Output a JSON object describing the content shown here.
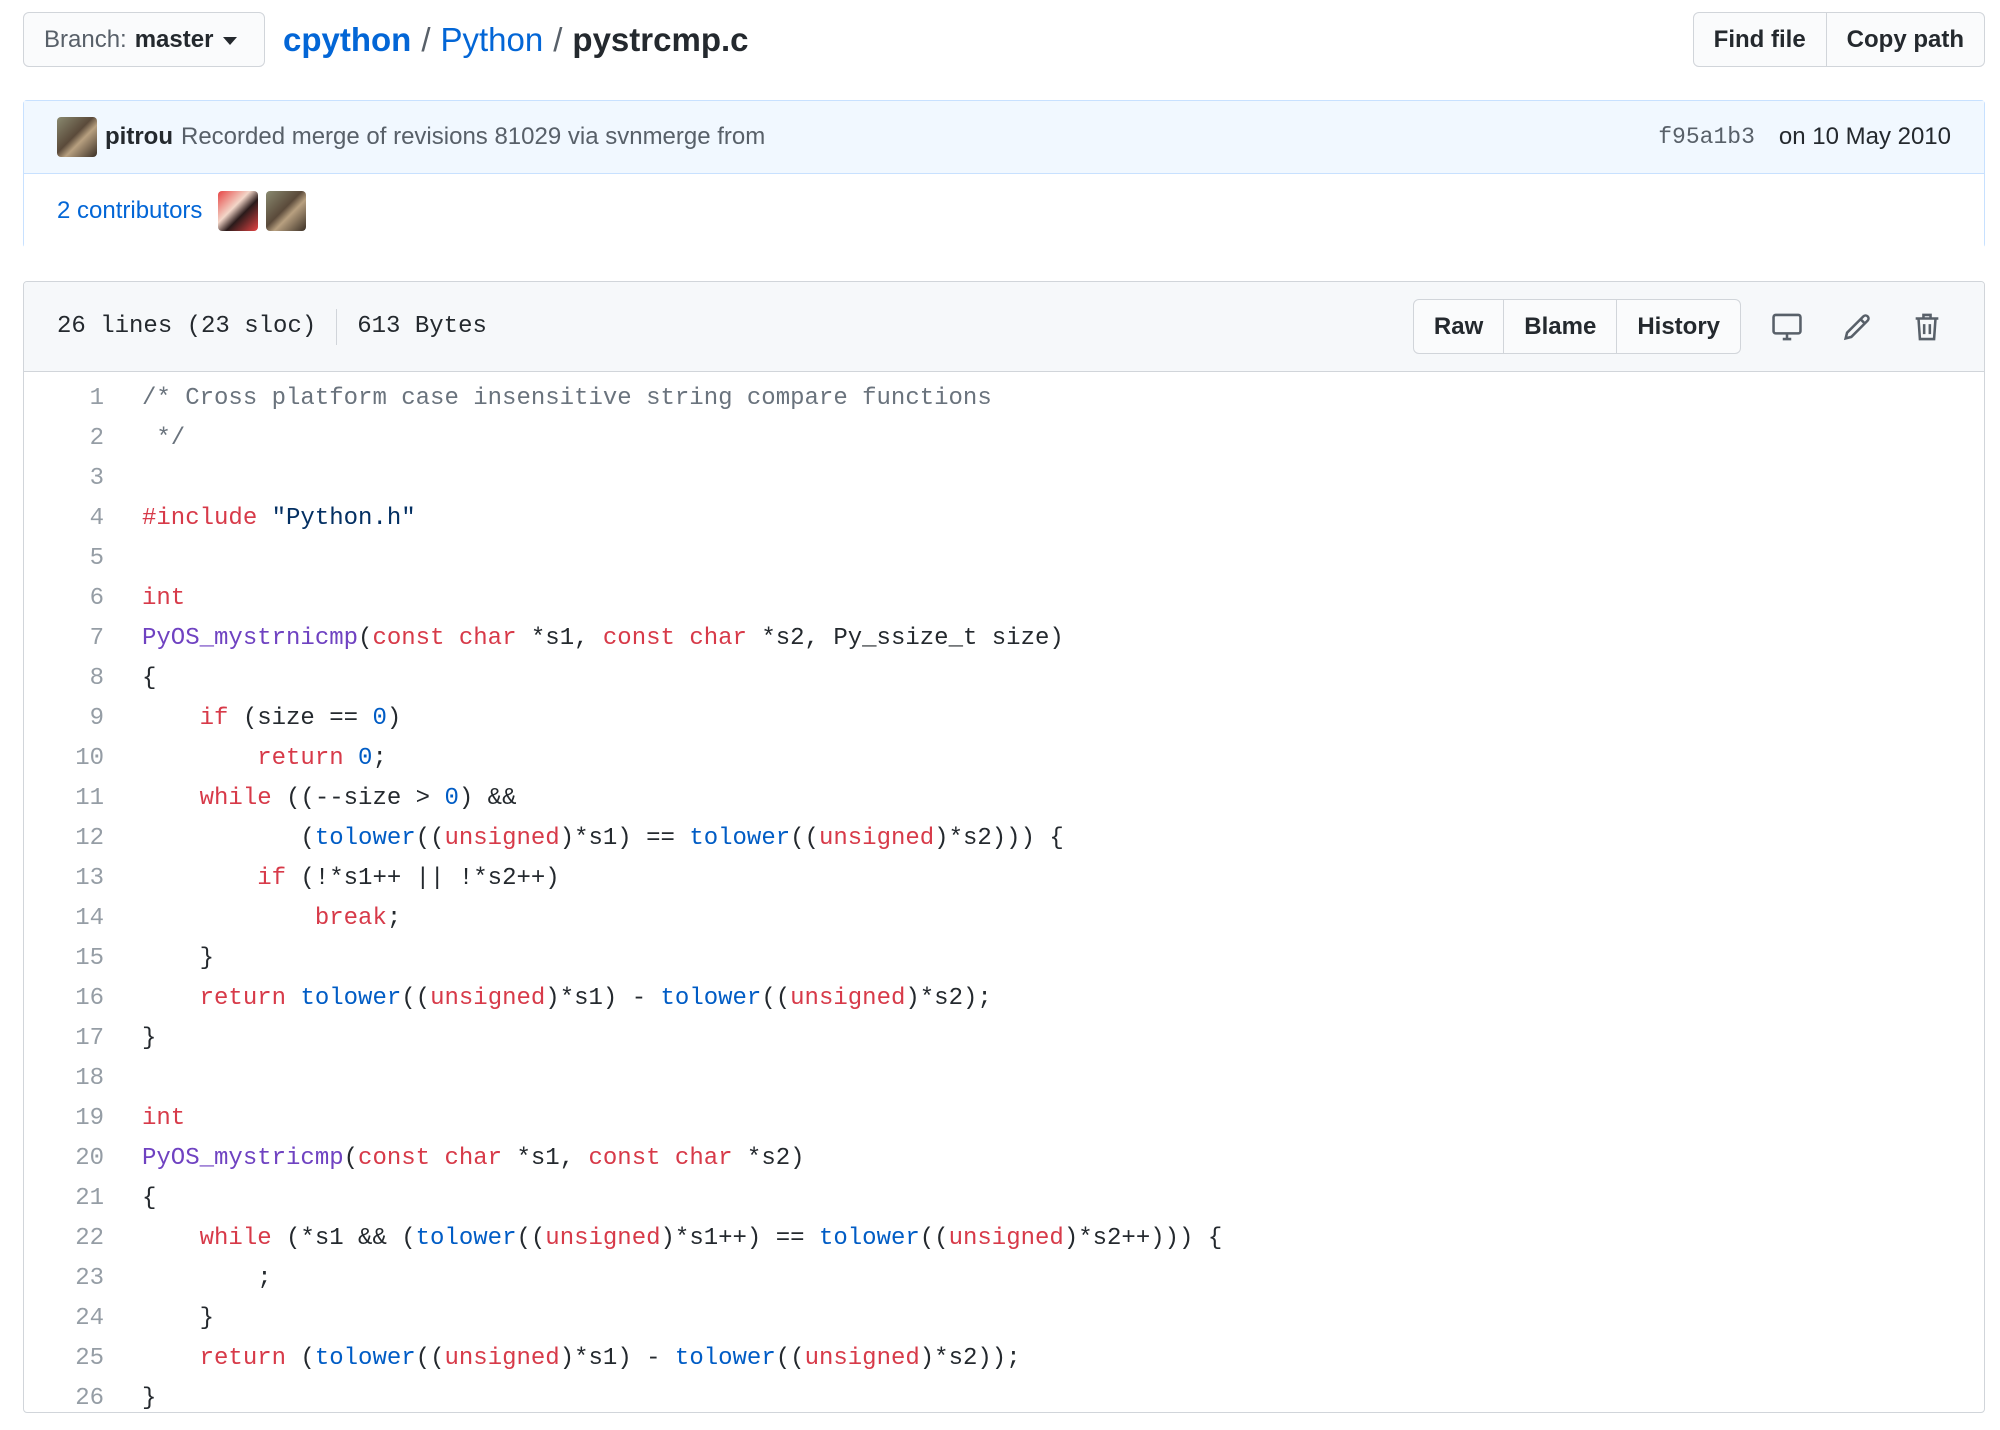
{
  "topbar": {
    "branch_label": "Branch:",
    "branch_value": "master",
    "breadcrumb": {
      "repo": "cpython",
      "sep1": "/",
      "dir": "Python",
      "sep2": "/",
      "file": "pystrcmp.c"
    },
    "find_file": "Find file",
    "copy_path": "Copy path"
  },
  "commit": {
    "author": "pitrou",
    "message": "Recorded merge of revisions 81029 via svnmerge from",
    "sha": "f95a1b3",
    "date": "on 10 May 2010",
    "contributors": "2 contributors"
  },
  "file": {
    "lines_info": "26 lines (23 sloc)",
    "size": "613 Bytes",
    "raw": "Raw",
    "blame": "Blame",
    "history": "History"
  },
  "code": {
    "lines": [
      [
        [
          "c",
          "/* Cross platform case insensitive string compare functions"
        ]
      ],
      [
        [
          "c",
          " */"
        ]
      ],
      [],
      [
        [
          "k",
          "#include"
        ],
        [
          "p",
          " "
        ],
        [
          "s",
          "\"Python.h\""
        ]
      ],
      [],
      [
        [
          "k",
          "int"
        ]
      ],
      [
        [
          "f",
          "PyOS_mystrnicmp"
        ],
        [
          "p",
          "("
        ],
        [
          "k",
          "const"
        ],
        [
          "p",
          " "
        ],
        [
          "k",
          "char"
        ],
        [
          "p",
          " *s1, "
        ],
        [
          "k",
          "const"
        ],
        [
          "p",
          " "
        ],
        [
          "k",
          "char"
        ],
        [
          "p",
          " *s2, Py_ssize_t size)"
        ]
      ],
      [
        [
          "p",
          "{"
        ]
      ],
      [
        [
          "p",
          "    "
        ],
        [
          "k",
          "if"
        ],
        [
          "p",
          " (size == "
        ],
        [
          "n",
          "0"
        ],
        [
          "p",
          ")"
        ]
      ],
      [
        [
          "p",
          "        "
        ],
        [
          "k",
          "return"
        ],
        [
          "p",
          " "
        ],
        [
          "n",
          "0"
        ],
        [
          "p",
          ";"
        ]
      ],
      [
        [
          "p",
          "    "
        ],
        [
          "k",
          "while"
        ],
        [
          "p",
          " ((--size > "
        ],
        [
          "n",
          "0"
        ],
        [
          "p",
          ") &&"
        ]
      ],
      [
        [
          "p",
          "           ("
        ],
        [
          "n",
          "tolower"
        ],
        [
          "p",
          "(("
        ],
        [
          "k",
          "unsigned"
        ],
        [
          "p",
          ")*s1) == "
        ],
        [
          "n",
          "tolower"
        ],
        [
          "p",
          "(("
        ],
        [
          "k",
          "unsigned"
        ],
        [
          "p",
          ")*s2))) {"
        ]
      ],
      [
        [
          "p",
          "        "
        ],
        [
          "k",
          "if"
        ],
        [
          "p",
          " (!*s1++ || !*s2++)"
        ]
      ],
      [
        [
          "p",
          "            "
        ],
        [
          "k",
          "break"
        ],
        [
          "p",
          ";"
        ]
      ],
      [
        [
          "p",
          "    }"
        ]
      ],
      [
        [
          "p",
          "    "
        ],
        [
          "k",
          "return"
        ],
        [
          "p",
          " "
        ],
        [
          "n",
          "tolower"
        ],
        [
          "p",
          "(("
        ],
        [
          "k",
          "unsigned"
        ],
        [
          "p",
          ")*s1) - "
        ],
        [
          "n",
          "tolower"
        ],
        [
          "p",
          "(("
        ],
        [
          "k",
          "unsigned"
        ],
        [
          "p",
          ")*s2);"
        ]
      ],
      [
        [
          "p",
          "}"
        ]
      ],
      [],
      [
        [
          "k",
          "int"
        ]
      ],
      [
        [
          "f",
          "PyOS_mystricmp"
        ],
        [
          "p",
          "("
        ],
        [
          "k",
          "const"
        ],
        [
          "p",
          " "
        ],
        [
          "k",
          "char"
        ],
        [
          "p",
          " *s1, "
        ],
        [
          "k",
          "const"
        ],
        [
          "p",
          " "
        ],
        [
          "k",
          "char"
        ],
        [
          "p",
          " *s2)"
        ]
      ],
      [
        [
          "p",
          "{"
        ]
      ],
      [
        [
          "p",
          "    "
        ],
        [
          "k",
          "while"
        ],
        [
          "p",
          " (*s1 && ("
        ],
        [
          "n",
          "tolower"
        ],
        [
          "p",
          "(("
        ],
        [
          "k",
          "unsigned"
        ],
        [
          "p",
          ")*s1++) == "
        ],
        [
          "n",
          "tolower"
        ],
        [
          "p",
          "(("
        ],
        [
          "k",
          "unsigned"
        ],
        [
          "p",
          ")*s2++))) {"
        ]
      ],
      [
        [
          "p",
          "        ;"
        ]
      ],
      [
        [
          "p",
          "    }"
        ]
      ],
      [
        [
          "p",
          "    "
        ],
        [
          "k",
          "return"
        ],
        [
          "p",
          " ("
        ],
        [
          "n",
          "tolower"
        ],
        [
          "p",
          "(("
        ],
        [
          "k",
          "unsigned"
        ],
        [
          "p",
          ")*s1) - "
        ],
        [
          "n",
          "tolower"
        ],
        [
          "p",
          "(("
        ],
        [
          "k",
          "unsigned"
        ],
        [
          "p",
          ")*s2));"
        ]
      ],
      [
        [
          "p",
          "}"
        ]
      ]
    ]
  }
}
